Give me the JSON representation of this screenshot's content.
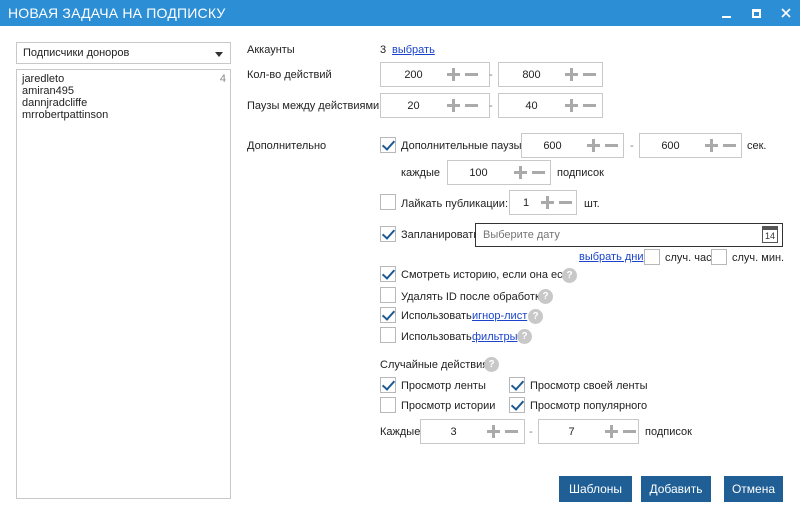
{
  "window": {
    "title": "НОВАЯ ЗАДАЧА НА ПОДПИСКУ"
  },
  "donors": {
    "dropdown_value": "Подписчики доноров",
    "count": "4",
    "items": [
      "jaredleto",
      "amiran495",
      "dannjradcliffe",
      "mrrobertpattinson"
    ]
  },
  "accounts": {
    "label": "Аккаунты",
    "count": "3",
    "select_link": "выбрать"
  },
  "actions_count": {
    "label": "Кол-во действий",
    "min": "200",
    "max": "800"
  },
  "pauses": {
    "label": "Паузы между действиями",
    "min": "20",
    "max": "40"
  },
  "additional": {
    "label": "Дополнительно",
    "extra_pauses": {
      "label": "Дополнительные паузы",
      "checked": true,
      "min": "600",
      "max": "600",
      "unit": "сек.",
      "every_label": "каждые",
      "every": "100",
      "every_unit": "подписок"
    },
    "like_posts": {
      "label": "Лайкать публикации:",
      "checked": false,
      "value": "1",
      "unit": "шт."
    },
    "schedule": {
      "label": "Запланировать",
      "checked": true,
      "date_placeholder": "Выберите дату",
      "calendar_day": "14",
      "select_days_link": "выбрать дни",
      "random_hour_label": "случ. час",
      "random_minute_label": "случ. мин.",
      "random_hour_checked": false,
      "random_minute_checked": false
    },
    "watch_story": {
      "label": "Смотреть историю, если она есть",
      "checked": true
    },
    "delete_id": {
      "label": "Удалять ID после обработки",
      "checked": false
    },
    "use_ignore": {
      "label": "Использовать",
      "link": "игнор-лист",
      "checked": true
    },
    "use_filters": {
      "label": "Использовать",
      "link": "фильтры",
      "checked": false
    },
    "help_glyph": "?"
  },
  "random_actions": {
    "label": "Случайные действия:",
    "view_feed": {
      "label": "Просмотр ленты",
      "checked": true
    },
    "view_own_feed": {
      "label": "Просмотр своей ленты",
      "checked": true
    },
    "view_stories": {
      "label": "Просмотр истории",
      "checked": false
    },
    "view_popular": {
      "label": "Просмотр популярного",
      "checked": true
    },
    "every_label": "Каждые",
    "min": "3",
    "max": "7",
    "unit": "подписок"
  },
  "buttons": {
    "templates": "Шаблоны",
    "add": "Добавить",
    "cancel": "Отмена"
  },
  "dash": "-",
  "colors": {
    "titlebar": "#2c8fd6",
    "button": "#1f5f96",
    "link": "#1a44cc",
    "check": "#1e5a90"
  }
}
